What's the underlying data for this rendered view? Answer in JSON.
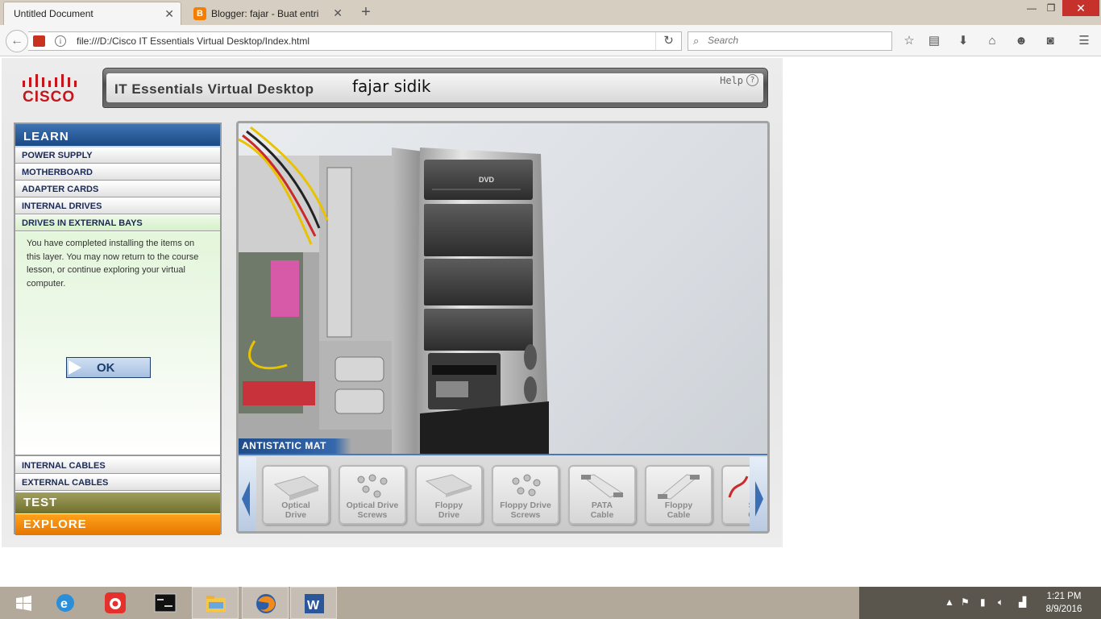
{
  "browser": {
    "tabs": [
      {
        "title": "Untitled Document",
        "active": true
      },
      {
        "title": "Blogger: fajar - Buat entri",
        "active": false
      }
    ],
    "url": "file:///D:/Cisco IT Essentials Virtual Desktop/Index.html",
    "search_placeholder": "Search",
    "toolbar_icons": [
      "bookmark-star-icon",
      "reader-view-icon",
      "download-icon",
      "home-icon",
      "hello-icon",
      "pocket-icon",
      "menu-icon"
    ]
  },
  "app": {
    "logo_text": "CISCO",
    "title": "IT Essentials Virtual Desktop",
    "user_name": "fajar sidik",
    "help_label": "Help",
    "sidebar": {
      "learn_label": "LEARN",
      "items_top": [
        "POWER SUPPLY",
        "MOTHERBOARD",
        "ADAPTER CARDS",
        "INTERNAL DRIVES",
        "DRIVES IN EXTERNAL BAYS"
      ],
      "active_item": "DRIVES IN EXTERNAL BAYS",
      "message": "You have completed installing the items on this layer. You may now return to the course lesson, or continue exploring your virtual computer.",
      "ok_label": "OK",
      "items_bottom": [
        "INTERNAL CABLES",
        "EXTERNAL CABLES"
      ],
      "test_label": "TEST",
      "explore_label": "EXPLORE"
    },
    "viewer": {
      "dvd_label": "DVD",
      "mat_label": "ANTISTATIC MAT",
      "tray_items": [
        {
          "line1": "Optical",
          "line2": "Drive"
        },
        {
          "line1": "Optical Drive",
          "line2": "Screws"
        },
        {
          "line1": "Floppy",
          "line2": "Drive"
        },
        {
          "line1": "Floppy Drive",
          "line2": "Screws"
        },
        {
          "line1": "PATA",
          "line2": "Cable"
        },
        {
          "line1": "Floppy",
          "line2": "Cable"
        },
        {
          "line1": "S",
          "line2": "C"
        }
      ]
    }
  },
  "taskbar": {
    "apps": [
      "start-icon",
      "internet-explorer-icon",
      "camera-app-icon",
      "command-prompt-icon",
      "file-explorer-icon",
      "firefox-icon",
      "word-icon"
    ],
    "time": "1:21 PM",
    "date": "8/9/2016"
  },
  "colors": {
    "learn": "#1a4a86",
    "test": "#706f2c",
    "explore": "#e57600",
    "cisco_red": "#c4161c",
    "message_bg": "#e4f6db"
  }
}
